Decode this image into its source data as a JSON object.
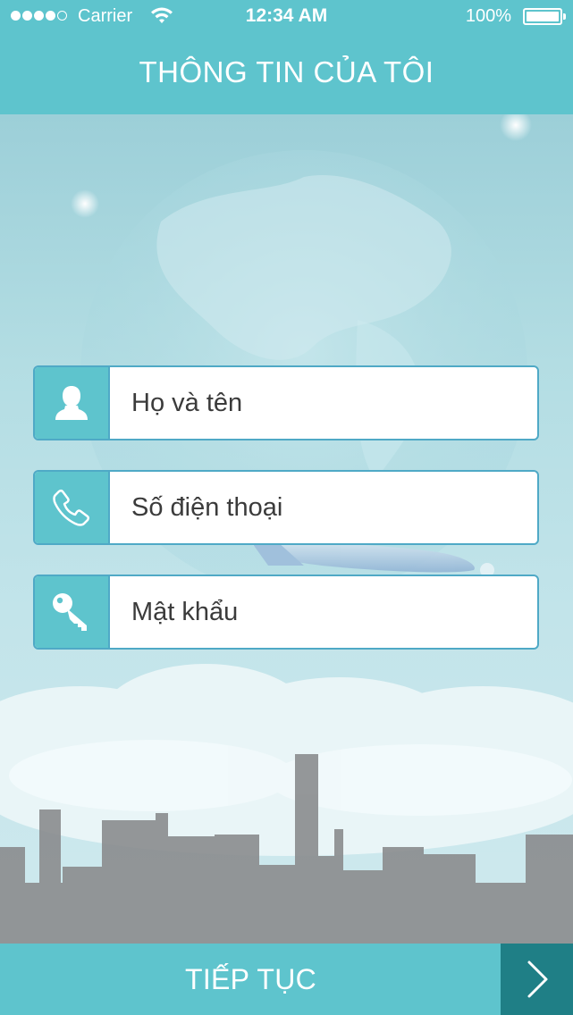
{
  "status_bar": {
    "carrier": "Carrier",
    "time": "12:34 AM",
    "battery": "100%",
    "signal_bars_filled": 4,
    "signal_bars_total": 5
  },
  "header": {
    "title": "THÔNG TIN CỦA TÔI"
  },
  "form": {
    "fields": [
      {
        "placeholder": "Họ và tên",
        "value": "",
        "icon": "user-icon"
      },
      {
        "placeholder": "Số điện thoại",
        "value": "",
        "icon": "phone-icon"
      },
      {
        "placeholder": "Mật khẩu",
        "value": "",
        "icon": "key-icon"
      }
    ]
  },
  "footer": {
    "continue_label": "TIẾP TỤC",
    "arrow_icon": "chevron-right-icon"
  },
  "colors": {
    "accent": "#5ec4cd",
    "accent_dark": "#1f7f86",
    "field_border": "#4fa9c6"
  }
}
